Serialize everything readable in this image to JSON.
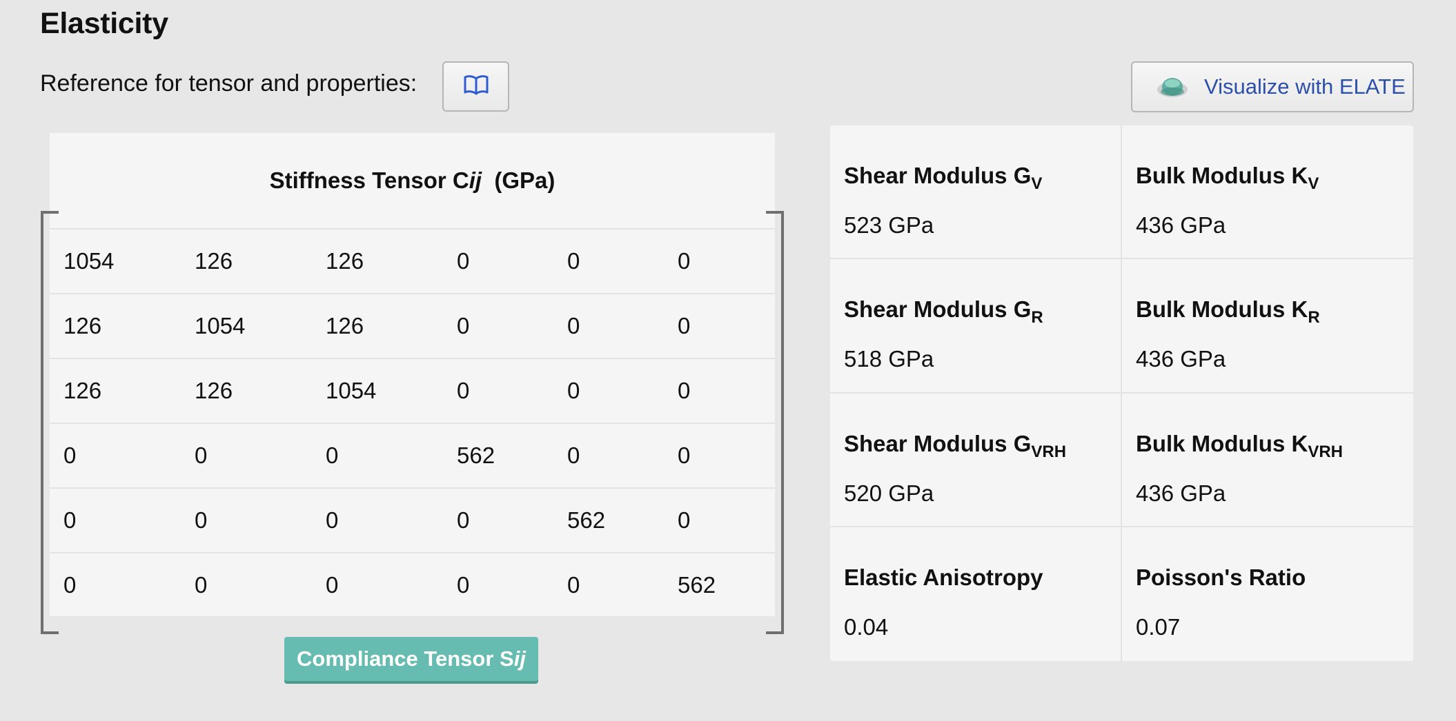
{
  "section_title": "Elasticity",
  "reference": {
    "label": "Reference for tensor and properties:",
    "button_icon": "book-icon"
  },
  "elate": {
    "label": "Visualize with ELATE",
    "icon": "elate-logo-icon"
  },
  "stiffness": {
    "title_prefix": "Stiffness Tensor C",
    "title_index": "ij",
    "title_unit": "(GPa)",
    "rows": [
      [
        "1054",
        "126",
        "126",
        "0",
        "0",
        "0"
      ],
      [
        "126",
        "1054",
        "126",
        "0",
        "0",
        "0"
      ],
      [
        "126",
        "126",
        "1054",
        "0",
        "0",
        "0"
      ],
      [
        "0",
        "0",
        "0",
        "562",
        "0",
        "0"
      ],
      [
        "0",
        "0",
        "0",
        "0",
        "562",
        "0"
      ],
      [
        "0",
        "0",
        "0",
        "0",
        "0",
        "562"
      ]
    ]
  },
  "compliance_button": {
    "prefix": "Compliance Tensor S",
    "index": "ij"
  },
  "properties": [
    {
      "name": "Shear Modulus G",
      "sub": "V",
      "value": "523 GPa"
    },
    {
      "name": "Bulk Modulus K",
      "sub": "V",
      "value": "436 GPa"
    },
    {
      "name": "Shear Modulus G",
      "sub": "R",
      "value": "518 GPa"
    },
    {
      "name": "Bulk Modulus K",
      "sub": "R",
      "value": "436 GPa"
    },
    {
      "name": "Shear Modulus G",
      "sub": "VRH",
      "value": "520 GPa"
    },
    {
      "name": "Bulk Modulus K",
      "sub": "VRH",
      "value": "436 GPa"
    },
    {
      "name": "Elastic Anisotropy",
      "sub": "",
      "value": "0.04"
    },
    {
      "name": "Poisson's Ratio",
      "sub": "",
      "value": "0.07"
    }
  ],
  "colors": {
    "background": "#e7e7e7",
    "panel": "#f5f5f5",
    "compliance_button": "#66bcb0",
    "elate_text": "#2c4fa8",
    "book_icon": "#2f5bd0"
  }
}
